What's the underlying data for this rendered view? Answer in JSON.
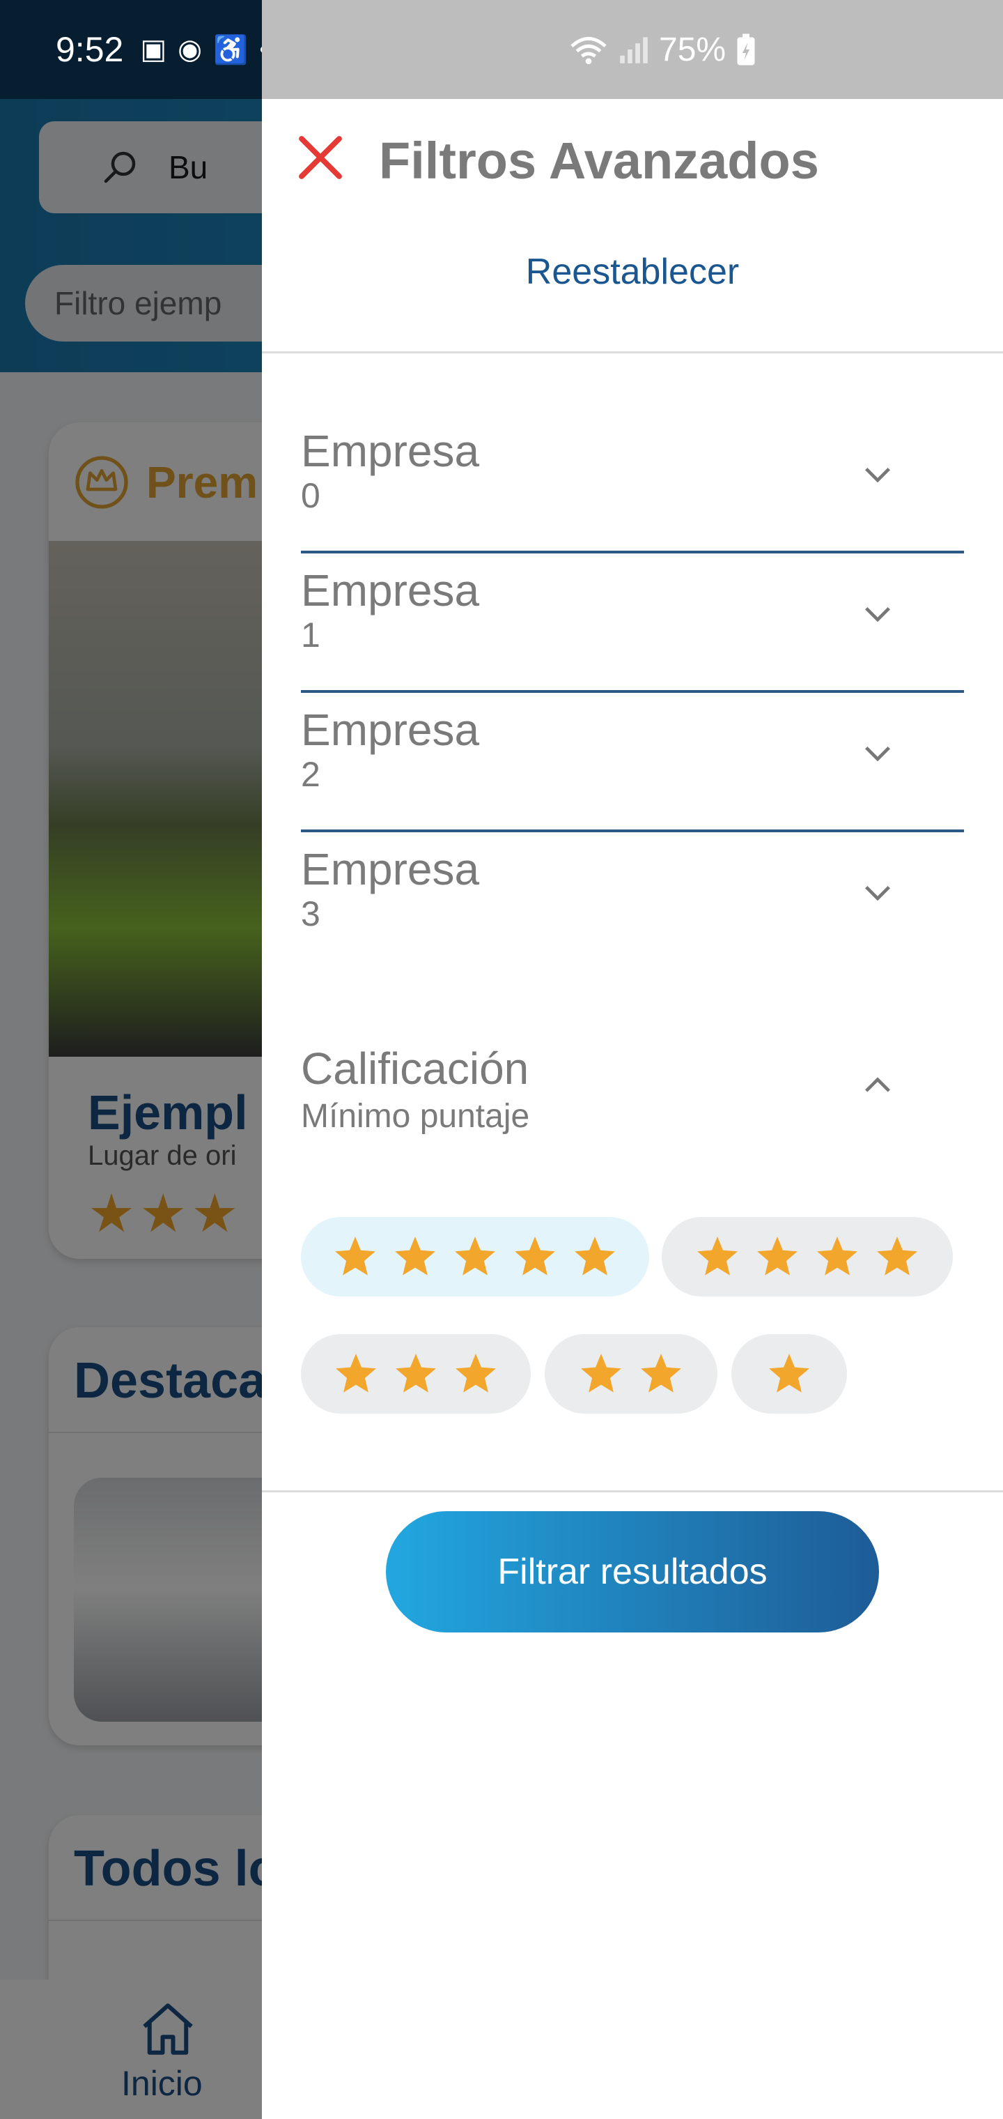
{
  "status_bar": {
    "time": "9:52",
    "battery": "75%",
    "left_icons": [
      "gallery-icon",
      "whatsapp-icon",
      "accessibility-icon",
      "dot-icon"
    ],
    "right_icons": [
      "wifi-icon",
      "signal-icon",
      "battery-charging-icon"
    ]
  },
  "background": {
    "search_placeholder": "Bu",
    "filter_chip": "Filtro ejemp",
    "premium_label": "Prem",
    "premium_card_title": "Ejempl",
    "premium_card_subtitle": "Lugar de ori",
    "premium_card_stars": "★★★",
    "featured_title": "Destaca",
    "all_title": "Todos lo",
    "nav_home_label": "Inicio"
  },
  "drawer": {
    "title": "Filtros Avanzados",
    "reset_label": "Reestablecer",
    "filters": [
      {
        "label": "Empresa",
        "value": "0"
      },
      {
        "label": "Empresa",
        "value": "1"
      },
      {
        "label": "Empresa",
        "value": "2"
      },
      {
        "label": "Empresa",
        "value": "3"
      }
    ],
    "rating": {
      "label": "Calificación",
      "sublabel": "Mínimo puntaje",
      "options": [
        {
          "stars": 5,
          "selected": true
        },
        {
          "stars": 4,
          "selected": false
        },
        {
          "stars": 3,
          "selected": false
        },
        {
          "stars": 2,
          "selected": false
        },
        {
          "stars": 1,
          "selected": false
        }
      ]
    },
    "apply_label": "Filtrar resultados"
  },
  "colors": {
    "accent_blue": "#1a5690",
    "close_red": "#e53935",
    "star_orange": "#f2a62b",
    "selected_chip": "#e3f4fb",
    "chip_gray": "#eaecee"
  }
}
